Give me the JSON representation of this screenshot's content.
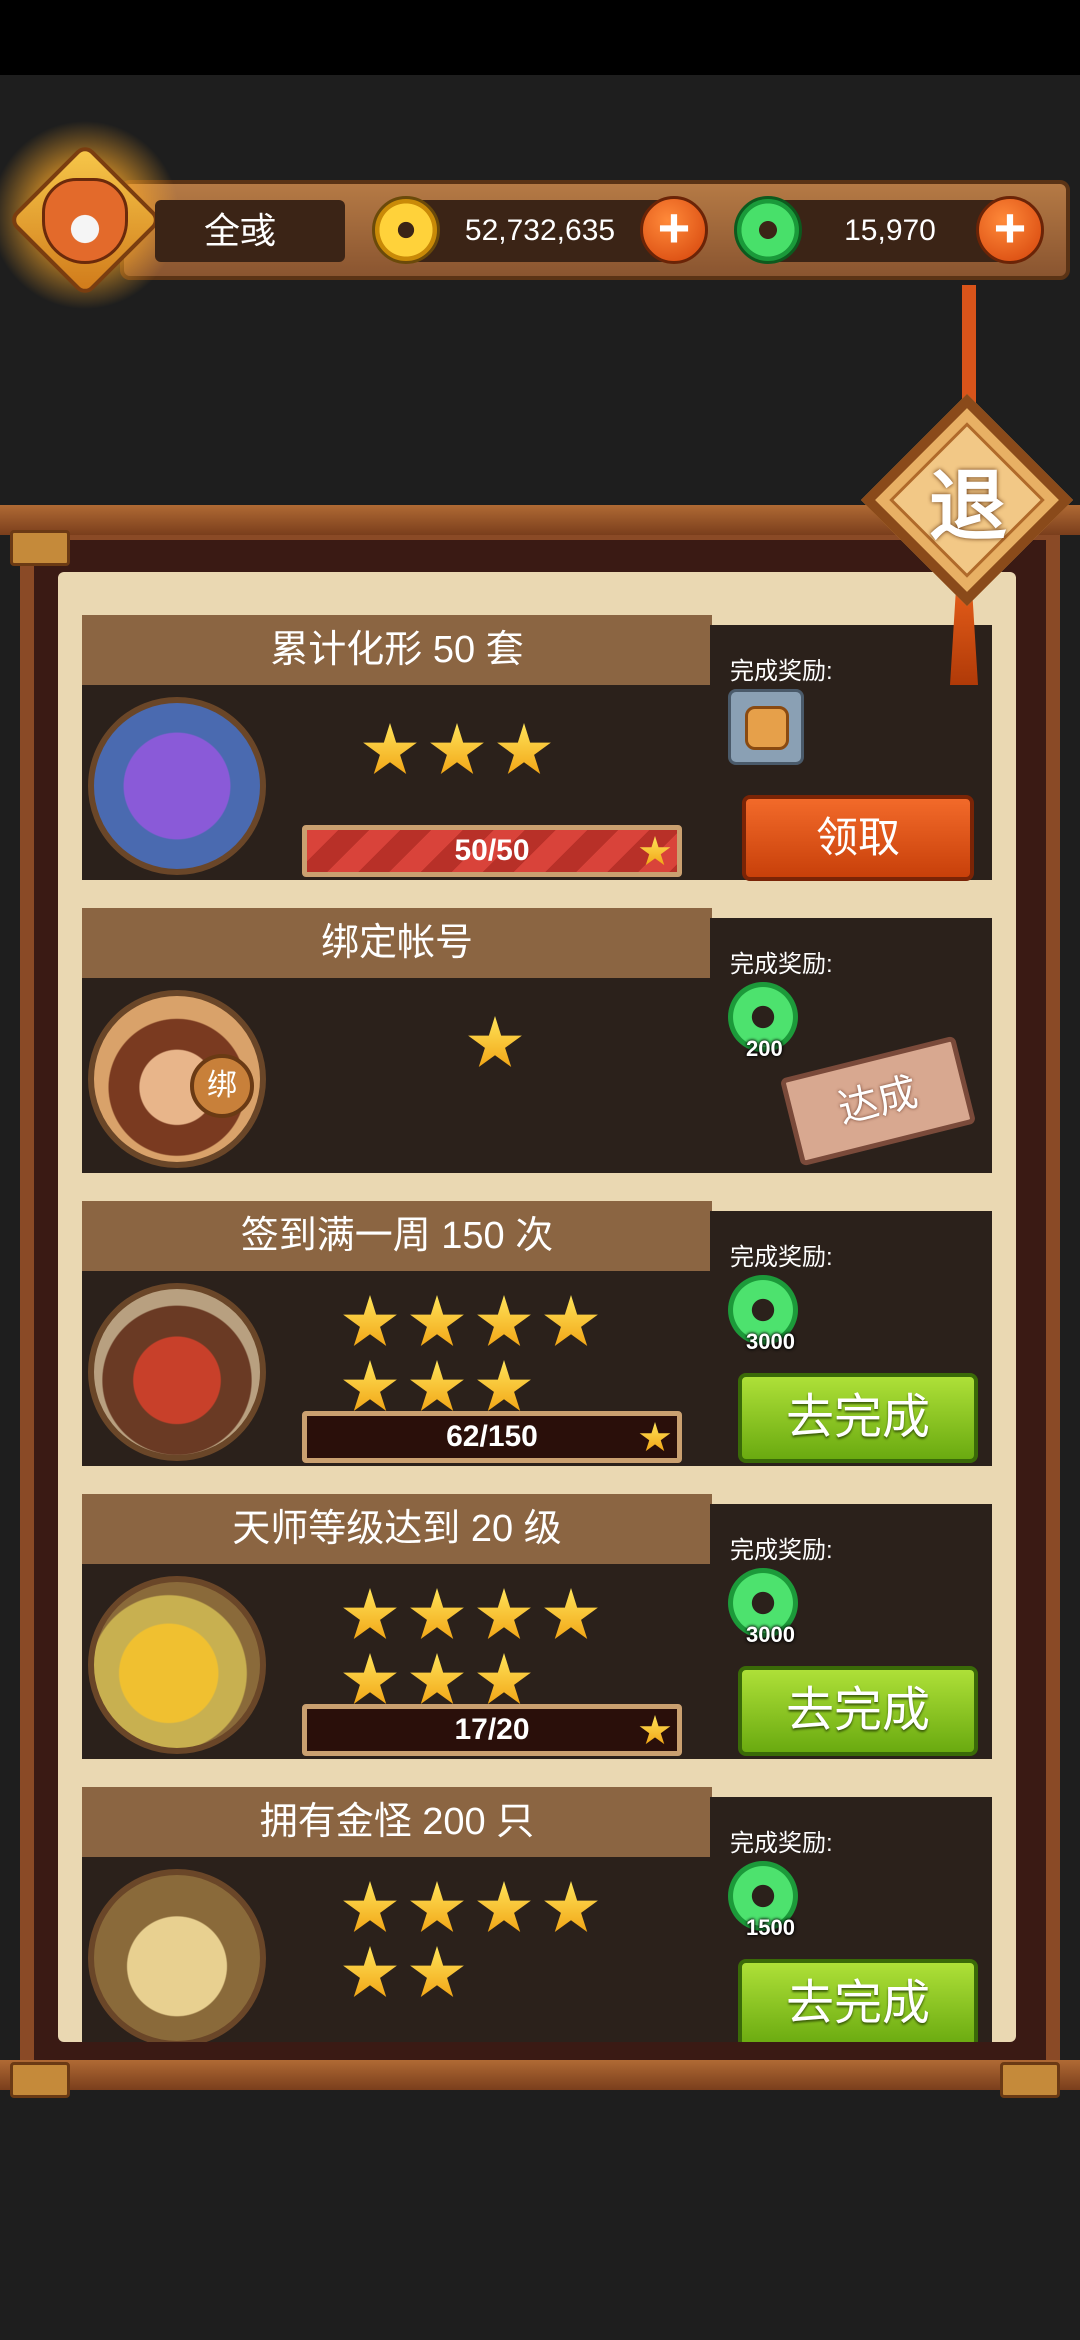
{
  "header": {
    "player_name": "全彧",
    "coins": "52,732,635",
    "jade": "15,970",
    "plus_label": "+"
  },
  "exit_label": "退",
  "reward_label": "完成奖励:",
  "tasks": [
    {
      "title": "累计化形 50 套",
      "stars": 3,
      "progress_text": "50/50",
      "progress": 1.0,
      "reward_type": "token",
      "reward_qty": "",
      "action": "领取",
      "action_type": "claim"
    },
    {
      "title": "绑定帐号",
      "stars": 1,
      "progress_text": "",
      "reward_type": "jade",
      "reward_qty": "200",
      "action": "达成",
      "action_type": "stamp",
      "portrait_badge": "绑"
    },
    {
      "title": "签到满一周 150 次",
      "stars": 7,
      "progress_text": "62/150",
      "progress": 0.41,
      "reward_type": "jade",
      "reward_qty": "3000",
      "action": "去完成",
      "action_type": "go"
    },
    {
      "title": "天师等级达到 20 级",
      "stars": 7,
      "progress_text": "17/20",
      "progress": 0.85,
      "reward_type": "jade",
      "reward_qty": "3000",
      "action": "去完成",
      "action_type": "go"
    },
    {
      "title": "拥有金怪 200 只",
      "stars": 6,
      "progress_text": "",
      "reward_type": "jade",
      "reward_qty": "1500",
      "action": "去完成",
      "action_type": "go"
    }
  ]
}
